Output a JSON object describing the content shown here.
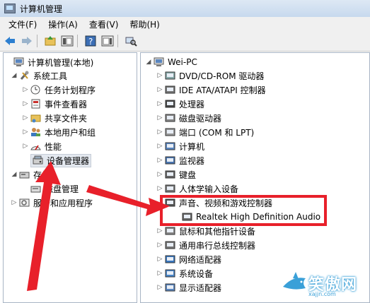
{
  "window": {
    "title": "计算机管理"
  },
  "menu": [
    "文件(F)",
    "操作(A)",
    "查看(V)",
    "帮助(H)"
  ],
  "left_tree": [
    {
      "label": "计算机管理(本地)",
      "icon": "computer-manage-icon",
      "expander": ""
    },
    {
      "label": "系统工具",
      "icon": "tools-icon",
      "expander": "◢"
    },
    {
      "label": "任务计划程序",
      "icon": "clock-icon",
      "expander": "▷"
    },
    {
      "label": "事件查看器",
      "icon": "event-viewer-icon",
      "expander": "▷"
    },
    {
      "label": "共享文件夹",
      "icon": "shared-folder-icon",
      "expander": "▷"
    },
    {
      "label": "本地用户和组",
      "icon": "users-icon",
      "expander": "▷"
    },
    {
      "label": "性能",
      "icon": "performance-icon",
      "expander": "▷"
    },
    {
      "label": "设备管理器",
      "icon": "device-manager-icon",
      "expander": ""
    },
    {
      "label": "存储",
      "icon": "storage-icon",
      "expander": "◢"
    },
    {
      "label": "磁盘管理",
      "icon": "disk-manage-icon",
      "expander": ""
    },
    {
      "label": "服务和应用程序",
      "icon": "services-icon",
      "expander": "▷"
    }
  ],
  "right_tree": {
    "root": "Wei-PC",
    "items": [
      {
        "label": "DVD/CD-ROM 驱动器",
        "icon": "dvd-icon"
      },
      {
        "label": "IDE ATA/ATAPI 控制器",
        "icon": "ide-icon"
      },
      {
        "label": "处理器",
        "icon": "processor-icon"
      },
      {
        "label": "磁盘驱动器",
        "icon": "disk-drive-icon"
      },
      {
        "label": "端口 (COM 和 LPT)",
        "icon": "port-icon"
      },
      {
        "label": "计算机",
        "icon": "computer-icon"
      },
      {
        "label": "监视器",
        "icon": "monitor-icon"
      },
      {
        "label": "键盘",
        "icon": "keyboard-icon"
      },
      {
        "label": "人体学输入设备",
        "icon": "hid-icon"
      },
      {
        "label": "声音、视频和游戏控制器",
        "icon": "sound-icon",
        "expanded": true
      },
      {
        "label": "Realtek High Definition Audio",
        "icon": "speaker-icon",
        "child": true
      },
      {
        "label": "鼠标和其他指针设备",
        "icon": "mouse-icon"
      },
      {
        "label": "通用串行总线控制器",
        "icon": "usb-icon"
      },
      {
        "label": "网络适配器",
        "icon": "network-icon"
      },
      {
        "label": "系统设备",
        "icon": "system-device-icon"
      },
      {
        "label": "显示适配器",
        "icon": "display-adapter-icon"
      }
    ]
  },
  "watermark": {
    "text": "笑傲网",
    "url": "xajjn.com"
  },
  "colors": {
    "annotation": "#e8202a",
    "titlebar": "#c7d9ee",
    "watermark": "#3aa0d8"
  }
}
